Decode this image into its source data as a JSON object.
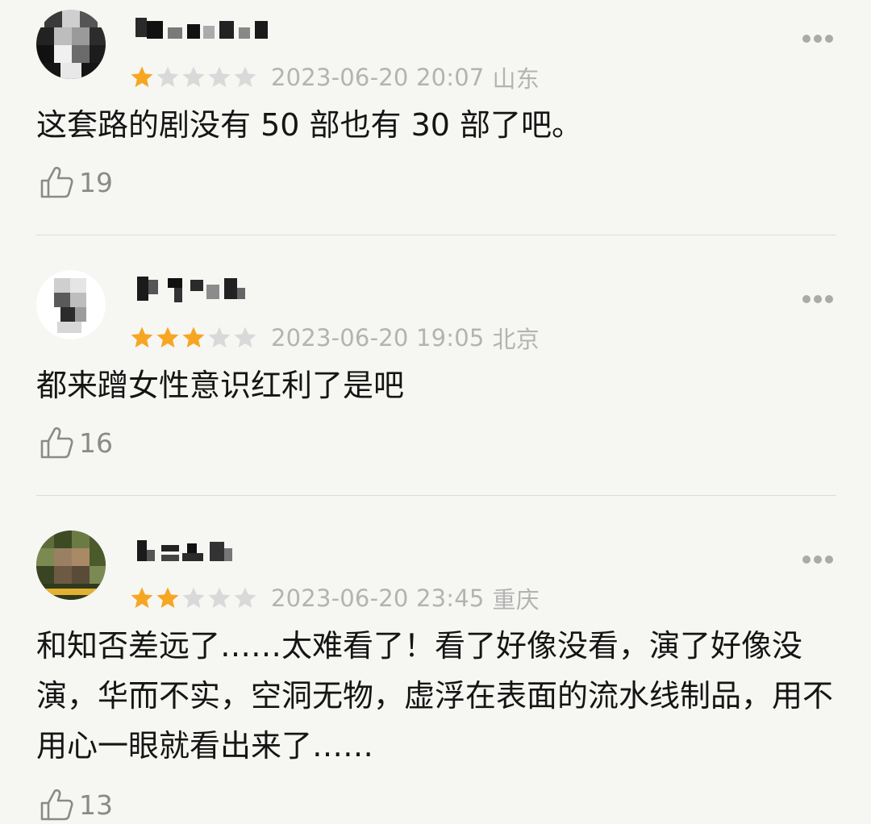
{
  "comments": [
    {
      "rating": 1,
      "date": "2023-06-20 20:07",
      "location": "山东",
      "text": "这套路的剧没有 50 部也有 30 部了吧。",
      "likes": "19"
    },
    {
      "rating": 3,
      "date": "2023-06-20 19:05",
      "location": "北京",
      "text": "都来蹭女性意识红利了是吧",
      "likes": "16"
    },
    {
      "rating": 2,
      "date": "2023-06-20 23:45",
      "location": "重庆",
      "text": "和知否差远了……太难看了！看了好像没看，演了好像没演，华而不实，空洞无物，虚浮在表面的流水线制品，用不用心一眼就看出来了……",
      "likes": "13"
    }
  ],
  "colors": {
    "star_filled": "#f6a623",
    "star_empty": "#d9d9d9",
    "background": "#f6f6f2"
  },
  "icons": {
    "more": "more-dots-icon",
    "like": "thumbs-up-icon",
    "star": "star-icon"
  }
}
